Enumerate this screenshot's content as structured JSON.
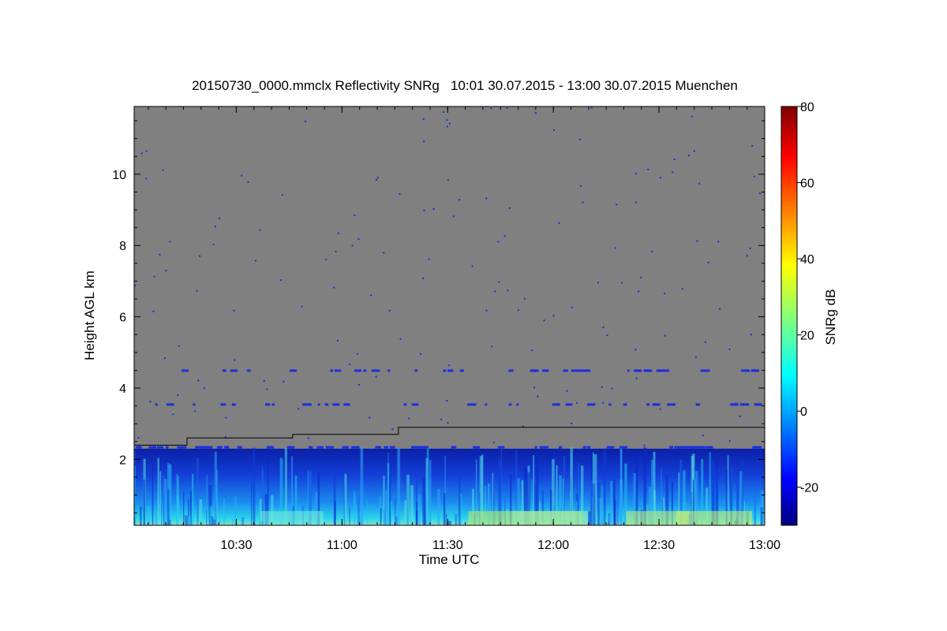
{
  "chart_data": {
    "type": "heatmap",
    "title": "20150730_0000.mmclx Reflectivity SNRg   10:01 30.07.2015 - 13:00 30.07.2015 Muenchen",
    "xlabel": "Time UTC",
    "ylabel": "Height AGL km",
    "colorbar_label": "SNRg dB",
    "x_range": [
      "10:01",
      "13:00"
    ],
    "y_range": [
      0.15,
      11.9
    ],
    "x_ticks": [
      "10:30",
      "11:00",
      "11:30",
      "12:00",
      "12:30",
      "13:00"
    ],
    "y_ticks": [
      "2",
      "4",
      "6",
      "8",
      "10"
    ],
    "colorbar_range": [
      -30,
      80
    ],
    "colorbar_ticks": [
      "-20",
      "0",
      "20",
      "40",
      "60",
      "80"
    ],
    "background_color": "#808080",
    "boundary_line": [
      {
        "t": "10:01",
        "h": 2.4
      },
      {
        "t": "10:16",
        "h": 2.4
      },
      {
        "t": "10:16",
        "h": 2.6
      },
      {
        "t": "10:46",
        "h": 2.6
      },
      {
        "t": "10:46",
        "h": 2.7
      },
      {
        "t": "11:16",
        "h": 2.7
      },
      {
        "t": "11:16",
        "h": 2.9
      },
      {
        "t": "13:00",
        "h": 2.9
      }
    ]
  }
}
